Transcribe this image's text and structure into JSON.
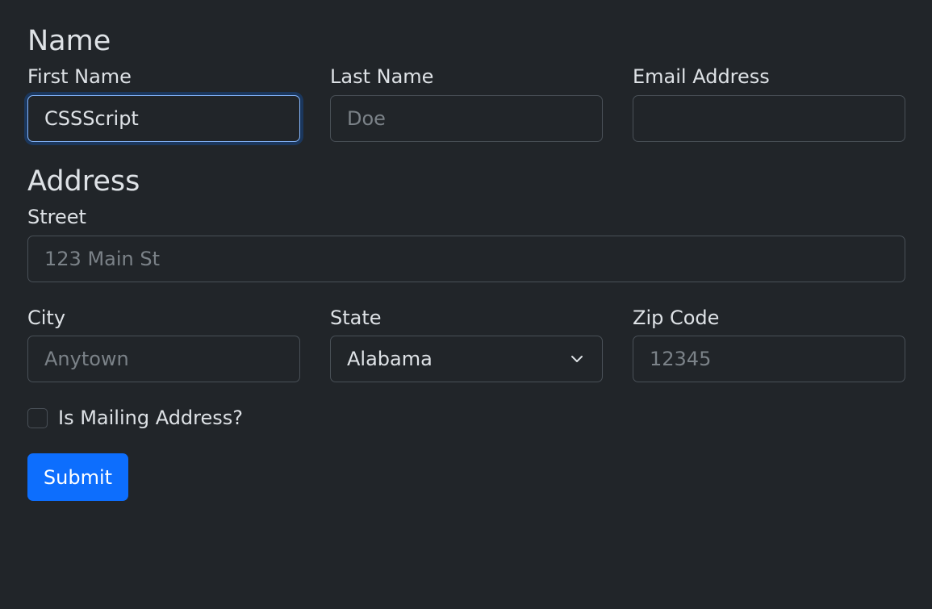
{
  "sections": {
    "name_title": "Name",
    "address_title": "Address"
  },
  "fields": {
    "first_name": {
      "label": "First Name",
      "value": "CSSScript",
      "placeholder": ""
    },
    "last_name": {
      "label": "Last Name",
      "value": "",
      "placeholder": "Doe"
    },
    "email": {
      "label": "Email Address",
      "value": "",
      "placeholder": ""
    },
    "street": {
      "label": "Street",
      "value": "",
      "placeholder": "123 Main St"
    },
    "city": {
      "label": "City",
      "value": "",
      "placeholder": "Anytown"
    },
    "state": {
      "label": "State",
      "value": "Alabama"
    },
    "zip": {
      "label": "Zip Code",
      "value": "",
      "placeholder": "12345"
    }
  },
  "checkbox": {
    "label": "Is Mailing Address?",
    "checked": false
  },
  "submit_label": "Submit",
  "colors": {
    "background": "#212529",
    "text": "#dee2e6",
    "border": "#495057",
    "placeholder": "#7b8288",
    "focus_border": "#86b7fe",
    "primary": "#0d6efd"
  },
  "icons": {
    "state_select": "chevron-down-icon"
  }
}
